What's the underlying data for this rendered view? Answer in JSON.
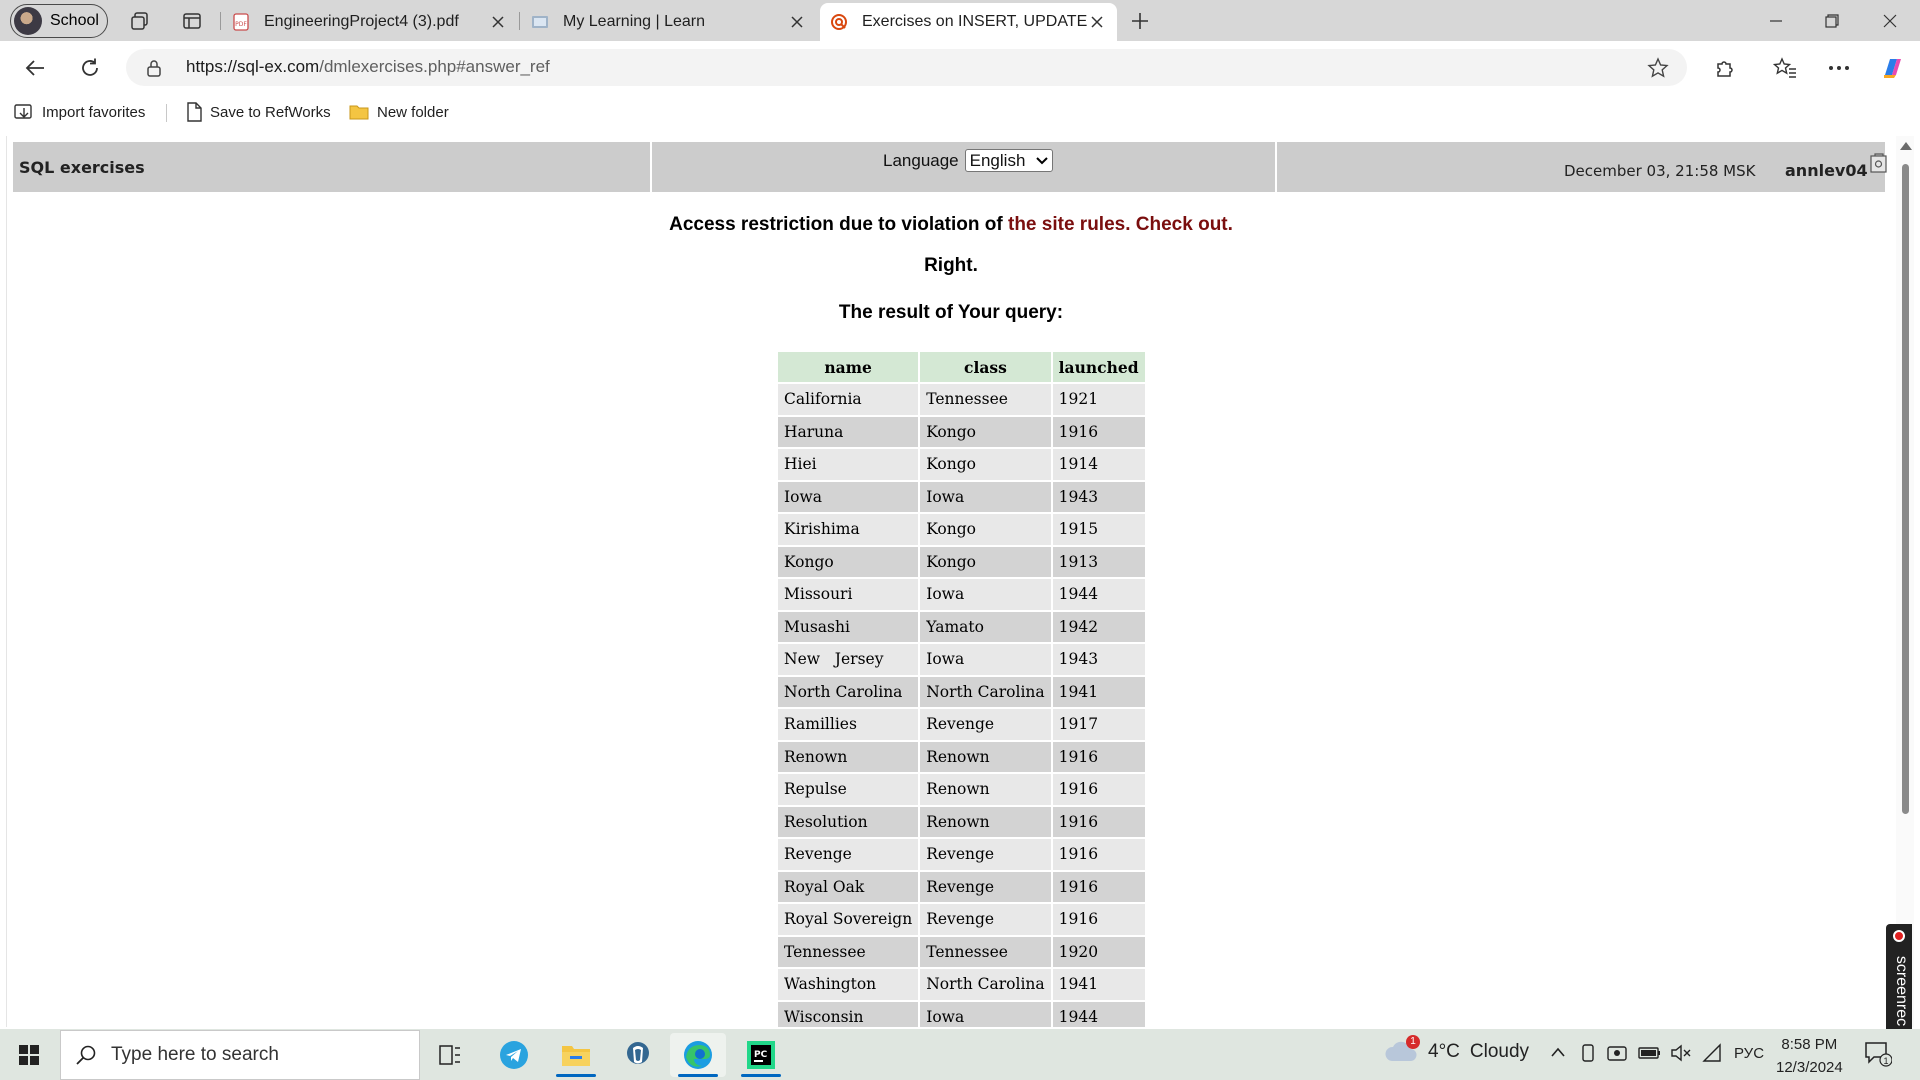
{
  "browser": {
    "profile_label": "School",
    "tabs": [
      {
        "title": "EngineeringProject4 (3).pdf",
        "active": false
      },
      {
        "title": "My Learning | Learn",
        "active": false
      },
      {
        "title": "Exercises on INSERT, UPDATE, DE",
        "active": true
      }
    ],
    "url_domain": "https://sql-ex.com",
    "url_path": "/dmlexercises.php#answer_ref",
    "favorites": [
      "Import favorites",
      "Save to RefWorks",
      "New folder"
    ]
  },
  "site": {
    "title": "SQL exercises",
    "language_label": "Language",
    "language_value": "English",
    "datetime": "December 03, 21:58 MSK",
    "username": "annlev04",
    "access_prefix": "Access restriction due to violation of",
    "access_link1": "the site rules.",
    "access_link2": "Check out.",
    "verdict": "Right.",
    "result_heading": "The result of Your query:"
  },
  "result_table": {
    "columns": [
      "name",
      "class",
      "launched"
    ],
    "rows": [
      [
        "California",
        "Tennessee",
        "1921"
      ],
      [
        "Haruna",
        "Kongo",
        "1916"
      ],
      [
        "Hiei",
        "Kongo",
        "1914"
      ],
      [
        "Iowa",
        "Iowa",
        "1943"
      ],
      [
        "Kirishima",
        "Kongo",
        "1915"
      ],
      [
        "Kongo",
        "Kongo",
        "1913"
      ],
      [
        "Missouri",
        "Iowa",
        "1944"
      ],
      [
        "Musashi",
        "Yamato",
        "1942"
      ],
      [
        "New   Jersey",
        "Iowa",
        "1943"
      ],
      [
        "North Carolina",
        "North Carolina",
        "1941"
      ],
      [
        "Ramillies",
        "Revenge",
        "1917"
      ],
      [
        "Renown",
        "Renown",
        "1916"
      ],
      [
        "Repulse",
        "Renown",
        "1916"
      ],
      [
        "Resolution",
        "Renown",
        "1916"
      ],
      [
        "Revenge",
        "Revenge",
        "1916"
      ],
      [
        "Royal Oak",
        "Revenge",
        "1916"
      ],
      [
        "Royal Sovereign",
        "Revenge",
        "1916"
      ],
      [
        "Tennessee",
        "Tennessee",
        "1920"
      ],
      [
        "Washington",
        "North Carolina",
        "1941"
      ],
      [
        "Wisconsin",
        "Iowa",
        "1944"
      ]
    ]
  },
  "overlay": {
    "screenrec_label": "screenrec"
  },
  "taskbar": {
    "search_placeholder": "Type here to search",
    "weather_temp": "4°C",
    "weather_desc": "Cloudy",
    "weather_badge": "1",
    "language": "РУС",
    "time": "8:58 PM",
    "date": "12/3/2024",
    "notification_count": "1"
  },
  "colors": {
    "header_bg": "#cccccc",
    "table_header_bg": "#d4e8d4",
    "row_light": "#e8e8e8",
    "row_dark": "#d3d3d3",
    "link_color": "#7a0e0e"
  }
}
